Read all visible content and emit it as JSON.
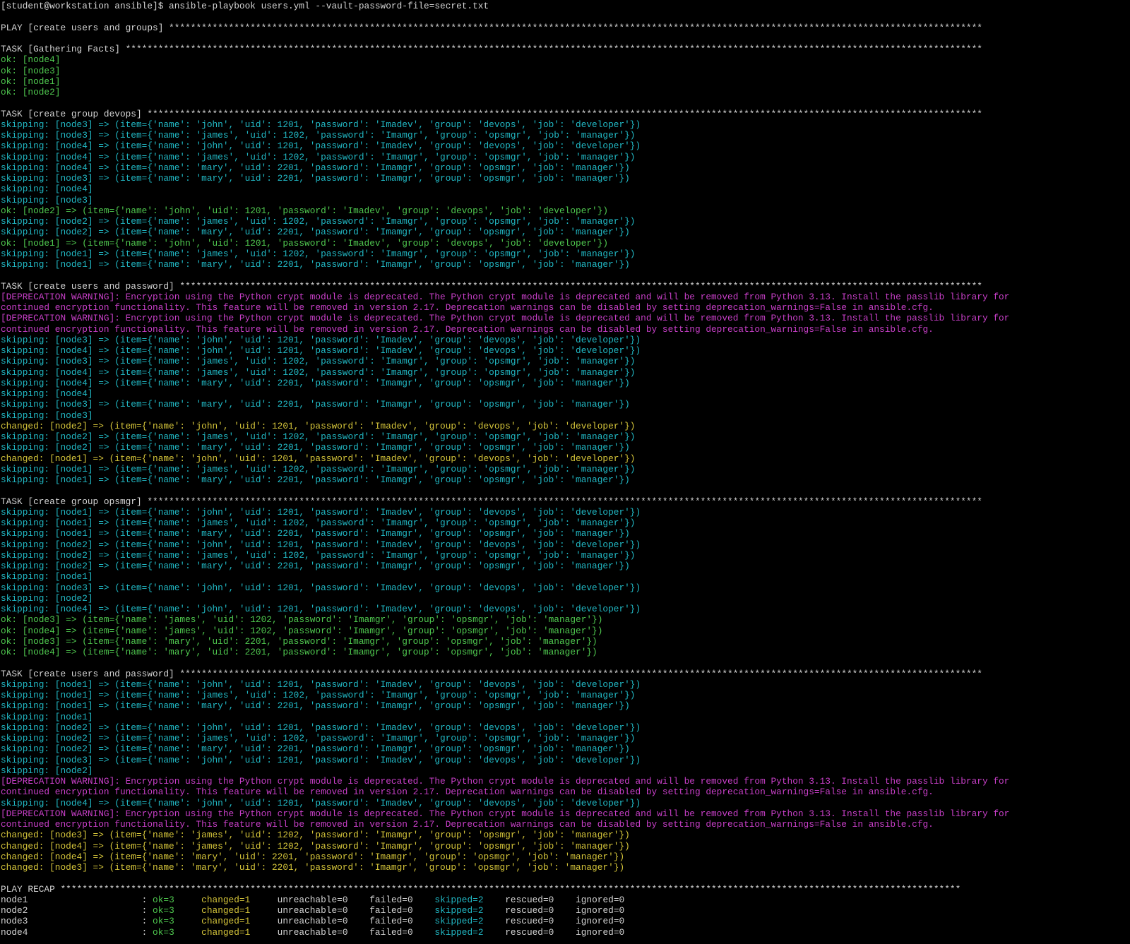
{
  "terminal": {
    "colors": {
      "background": "#000000",
      "default": "#d4d4d4",
      "ok": "#4fc84f",
      "skipping": "#21b8c4",
      "changed": "#d4c43a",
      "warning": "#c83fc8"
    },
    "lines": [
      {
        "kind": "prompt",
        "text": "[student@workstation ansible]$ ansible-playbook users.yml --vault-password-file=secret.txt"
      },
      {
        "kind": "blank",
        "text": ""
      },
      {
        "kind": "header",
        "text": "PLAY [create users and groups] ******************************************************************************************************************************************************"
      },
      {
        "kind": "blank",
        "text": ""
      },
      {
        "kind": "header",
        "text": "TASK [Gathering Facts] **************************************************************************************************************************************************************"
      },
      {
        "kind": "ok",
        "text": "ok: [node4]"
      },
      {
        "kind": "ok",
        "text": "ok: [node3]"
      },
      {
        "kind": "ok",
        "text": "ok: [node1]"
      },
      {
        "kind": "ok",
        "text": "ok: [node2]"
      },
      {
        "kind": "blank",
        "text": ""
      },
      {
        "kind": "header",
        "text": "TASK [create group devops] **********************************************************************************************************************************************************"
      },
      {
        "kind": "skip",
        "text": "skipping: [node3] => (item={'name': 'john', 'uid': 1201, 'password': 'Imadev', 'group': 'devops', 'job': 'developer'})"
      },
      {
        "kind": "skip",
        "text": "skipping: [node3] => (item={'name': 'james', 'uid': 1202, 'password': 'Imamgr', 'group': 'opsmgr', 'job': 'manager'})"
      },
      {
        "kind": "skip",
        "text": "skipping: [node4] => (item={'name': 'john', 'uid': 1201, 'password': 'Imadev', 'group': 'devops', 'job': 'developer'})"
      },
      {
        "kind": "skip",
        "text": "skipping: [node4] => (item={'name': 'james', 'uid': 1202, 'password': 'Imamgr', 'group': 'opsmgr', 'job': 'manager'})"
      },
      {
        "kind": "skip",
        "text": "skipping: [node4] => (item={'name': 'mary', 'uid': 2201, 'password': 'Imamgr', 'group': 'opsmgr', 'job': 'manager'})"
      },
      {
        "kind": "skip",
        "text": "skipping: [node3] => (item={'name': 'mary', 'uid': 2201, 'password': 'Imamgr', 'group': 'opsmgr', 'job': 'manager'})"
      },
      {
        "kind": "skip",
        "text": "skipping: [node4]"
      },
      {
        "kind": "skip",
        "text": "skipping: [node3]"
      },
      {
        "kind": "ok",
        "text": "ok: [node2] => (item={'name': 'john', 'uid': 1201, 'password': 'Imadev', 'group': 'devops', 'job': 'developer'})"
      },
      {
        "kind": "skip",
        "text": "skipping: [node2] => (item={'name': 'james', 'uid': 1202, 'password': 'Imamgr', 'group': 'opsmgr', 'job': 'manager'})"
      },
      {
        "kind": "skip",
        "text": "skipping: [node2] => (item={'name': 'mary', 'uid': 2201, 'password': 'Imamgr', 'group': 'opsmgr', 'job': 'manager'})"
      },
      {
        "kind": "ok",
        "text": "ok: [node1] => (item={'name': 'john', 'uid': 1201, 'password': 'Imadev', 'group': 'devops', 'job': 'developer'})"
      },
      {
        "kind": "skip",
        "text": "skipping: [node1] => (item={'name': 'james', 'uid': 1202, 'password': 'Imamgr', 'group': 'opsmgr', 'job': 'manager'})"
      },
      {
        "kind": "skip",
        "text": "skipping: [node1] => (item={'name': 'mary', 'uid': 2201, 'password': 'Imamgr', 'group': 'opsmgr', 'job': 'manager'})"
      },
      {
        "kind": "blank",
        "text": ""
      },
      {
        "kind": "header",
        "text": "TASK [create users and password] ****************************************************************************************************************************************************"
      },
      {
        "kind": "warn",
        "text": "[DEPRECATION WARNING]: Encryption using the Python crypt module is deprecated. The Python crypt module is deprecated and will be removed from Python 3.13. Install the passlib library for"
      },
      {
        "kind": "warn",
        "text": "continued encryption functionality. This feature will be removed in version 2.17. Deprecation warnings can be disabled by setting deprecation_warnings=False in ansible.cfg."
      },
      {
        "kind": "warn",
        "text": "[DEPRECATION WARNING]: Encryption using the Python crypt module is deprecated. The Python crypt module is deprecated and will be removed from Python 3.13. Install the passlib library for"
      },
      {
        "kind": "warn",
        "text": "continued encryption functionality. This feature will be removed in version 2.17. Deprecation warnings can be disabled by setting deprecation_warnings=False in ansible.cfg."
      },
      {
        "kind": "skip",
        "text": "skipping: [node3] => (item={'name': 'john', 'uid': 1201, 'password': 'Imadev', 'group': 'devops', 'job': 'developer'})"
      },
      {
        "kind": "skip",
        "text": "skipping: [node4] => (item={'name': 'john', 'uid': 1201, 'password': 'Imadev', 'group': 'devops', 'job': 'developer'})"
      },
      {
        "kind": "skip",
        "text": "skipping: [node3] => (item={'name': 'james', 'uid': 1202, 'password': 'Imamgr', 'group': 'opsmgr', 'job': 'manager'})"
      },
      {
        "kind": "skip",
        "text": "skipping: [node4] => (item={'name': 'james', 'uid': 1202, 'password': 'Imamgr', 'group': 'opsmgr', 'job': 'manager'})"
      },
      {
        "kind": "skip",
        "text": "skipping: [node4] => (item={'name': 'mary', 'uid': 2201, 'password': 'Imamgr', 'group': 'opsmgr', 'job': 'manager'})"
      },
      {
        "kind": "skip",
        "text": "skipping: [node4]"
      },
      {
        "kind": "skip",
        "text": "skipping: [node3] => (item={'name': 'mary', 'uid': 2201, 'password': 'Imamgr', 'group': 'opsmgr', 'job': 'manager'})"
      },
      {
        "kind": "skip",
        "text": "skipping: [node3]"
      },
      {
        "kind": "changed",
        "text": "changed: [node2] => (item={'name': 'john', 'uid': 1201, 'password': 'Imadev', 'group': 'devops', 'job': 'developer'})"
      },
      {
        "kind": "skip",
        "text": "skipping: [node2] => (item={'name': 'james', 'uid': 1202, 'password': 'Imamgr', 'group': 'opsmgr', 'job': 'manager'})"
      },
      {
        "kind": "skip",
        "text": "skipping: [node2] => (item={'name': 'mary', 'uid': 2201, 'password': 'Imamgr', 'group': 'opsmgr', 'job': 'manager'})"
      },
      {
        "kind": "changed",
        "text": "changed: [node1] => (item={'name': 'john', 'uid': 1201, 'password': 'Imadev', 'group': 'devops', 'job': 'developer'})"
      },
      {
        "kind": "skip",
        "text": "skipping: [node1] => (item={'name': 'james', 'uid': 1202, 'password': 'Imamgr', 'group': 'opsmgr', 'job': 'manager'})"
      },
      {
        "kind": "skip",
        "text": "skipping: [node1] => (item={'name': 'mary', 'uid': 2201, 'password': 'Imamgr', 'group': 'opsmgr', 'job': 'manager'})"
      },
      {
        "kind": "blank",
        "text": ""
      },
      {
        "kind": "header",
        "text": "TASK [create group opsmgr] **********************************************************************************************************************************************************"
      },
      {
        "kind": "skip",
        "text": "skipping: [node1] => (item={'name': 'john', 'uid': 1201, 'password': 'Imadev', 'group': 'devops', 'job': 'developer'})"
      },
      {
        "kind": "skip",
        "text": "skipping: [node1] => (item={'name': 'james', 'uid': 1202, 'password': 'Imamgr', 'group': 'opsmgr', 'job': 'manager'})"
      },
      {
        "kind": "skip",
        "text": "skipping: [node1] => (item={'name': 'mary', 'uid': 2201, 'password': 'Imamgr', 'group': 'opsmgr', 'job': 'manager'})"
      },
      {
        "kind": "skip",
        "text": "skipping: [node2] => (item={'name': 'john', 'uid': 1201, 'password': 'Imadev', 'group': 'devops', 'job': 'developer'})"
      },
      {
        "kind": "skip",
        "text": "skipping: [node2] => (item={'name': 'james', 'uid': 1202, 'password': 'Imamgr', 'group': 'opsmgr', 'job': 'manager'})"
      },
      {
        "kind": "skip",
        "text": "skipping: [node2] => (item={'name': 'mary', 'uid': 2201, 'password': 'Imamgr', 'group': 'opsmgr', 'job': 'manager'})"
      },
      {
        "kind": "skip",
        "text": "skipping: [node1]"
      },
      {
        "kind": "skip",
        "text": "skipping: [node3] => (item={'name': 'john', 'uid': 1201, 'password': 'Imadev', 'group': 'devops', 'job': 'developer'})"
      },
      {
        "kind": "skip",
        "text": "skipping: [node2]"
      },
      {
        "kind": "skip",
        "text": "skipping: [node4] => (item={'name': 'john', 'uid': 1201, 'password': 'Imadev', 'group': 'devops', 'job': 'developer'})"
      },
      {
        "kind": "ok",
        "text": "ok: [node3] => (item={'name': 'james', 'uid': 1202, 'password': 'Imamgr', 'group': 'opsmgr', 'job': 'manager'})"
      },
      {
        "kind": "ok",
        "text": "ok: [node4] => (item={'name': 'james', 'uid': 1202, 'password': 'Imamgr', 'group': 'opsmgr', 'job': 'manager'})"
      },
      {
        "kind": "ok",
        "text": "ok: [node3] => (item={'name': 'mary', 'uid': 2201, 'password': 'Imamgr', 'group': 'opsmgr', 'job': 'manager'})"
      },
      {
        "kind": "ok",
        "text": "ok: [node4] => (item={'name': 'mary', 'uid': 2201, 'password': 'Imamgr', 'group': 'opsmgr', 'job': 'manager'})"
      },
      {
        "kind": "blank",
        "text": ""
      },
      {
        "kind": "header",
        "text": "TASK [create users and password] ****************************************************************************************************************************************************"
      },
      {
        "kind": "skip",
        "text": "skipping: [node1] => (item={'name': 'john', 'uid': 1201, 'password': 'Imadev', 'group': 'devops', 'job': 'developer'})"
      },
      {
        "kind": "skip",
        "text": "skipping: [node1] => (item={'name': 'james', 'uid': 1202, 'password': 'Imamgr', 'group': 'opsmgr', 'job': 'manager'})"
      },
      {
        "kind": "skip",
        "text": "skipping: [node1] => (item={'name': 'mary', 'uid': 2201, 'password': 'Imamgr', 'group': 'opsmgr', 'job': 'manager'})"
      },
      {
        "kind": "skip",
        "text": "skipping: [node1]"
      },
      {
        "kind": "skip",
        "text": "skipping: [node2] => (item={'name': 'john', 'uid': 1201, 'password': 'Imadev', 'group': 'devops', 'job': 'developer'})"
      },
      {
        "kind": "skip",
        "text": "skipping: [node2] => (item={'name': 'james', 'uid': 1202, 'password': 'Imamgr', 'group': 'opsmgr', 'job': 'manager'})"
      },
      {
        "kind": "skip",
        "text": "skipping: [node2] => (item={'name': 'mary', 'uid': 2201, 'password': 'Imamgr', 'group': 'opsmgr', 'job': 'manager'})"
      },
      {
        "kind": "skip",
        "text": "skipping: [node3] => (item={'name': 'john', 'uid': 1201, 'password': 'Imadev', 'group': 'devops', 'job': 'developer'})"
      },
      {
        "kind": "skip",
        "text": "skipping: [node2]"
      },
      {
        "kind": "warn",
        "text": "[DEPRECATION WARNING]: Encryption using the Python crypt module is deprecated. The Python crypt module is deprecated and will be removed from Python 3.13. Install the passlib library for"
      },
      {
        "kind": "warn",
        "text": "continued encryption functionality. This feature will be removed in version 2.17. Deprecation warnings can be disabled by setting deprecation_warnings=False in ansible.cfg."
      },
      {
        "kind": "skip",
        "text": "skipping: [node4] => (item={'name': 'john', 'uid': 1201, 'password': 'Imadev', 'group': 'devops', 'job': 'developer'})"
      },
      {
        "kind": "warn",
        "text": "[DEPRECATION WARNING]: Encryption using the Python crypt module is deprecated. The Python crypt module is deprecated and will be removed from Python 3.13. Install the passlib library for"
      },
      {
        "kind": "warn",
        "text": "continued encryption functionality. This feature will be removed in version 2.17. Deprecation warnings can be disabled by setting deprecation_warnings=False in ansible.cfg."
      },
      {
        "kind": "changed",
        "text": "changed: [node3] => (item={'name': 'james', 'uid': 1202, 'password': 'Imamgr', 'group': 'opsmgr', 'job': 'manager'})"
      },
      {
        "kind": "changed",
        "text": "changed: [node4] => (item={'name': 'james', 'uid': 1202, 'password': 'Imamgr', 'group': 'opsmgr', 'job': 'manager'})"
      },
      {
        "kind": "changed",
        "text": "changed: [node4] => (item={'name': 'mary', 'uid': 2201, 'password': 'Imamgr', 'group': 'opsmgr', 'job': 'manager'})"
      },
      {
        "kind": "changed",
        "text": "changed: [node3] => (item={'name': 'mary', 'uid': 2201, 'password': 'Imamgr', 'group': 'opsmgr', 'job': 'manager'})"
      },
      {
        "kind": "blank",
        "text": ""
      },
      {
        "kind": "header",
        "text": "PLAY RECAP **********************************************************************************************************************************************************************"
      }
    ],
    "recap": [
      {
        "host": "node1",
        "ok": "ok=3",
        "changed": "changed=1",
        "unreachable": "unreachable=0",
        "failed": "failed=0",
        "skipped": "skipped=2",
        "rescued": "rescued=0",
        "ignored": "ignored=0"
      },
      {
        "host": "node2",
        "ok": "ok=3",
        "changed": "changed=1",
        "unreachable": "unreachable=0",
        "failed": "failed=0",
        "skipped": "skipped=2",
        "rescued": "rescued=0",
        "ignored": "ignored=0"
      },
      {
        "host": "node3",
        "ok": "ok=3",
        "changed": "changed=1",
        "unreachable": "unreachable=0",
        "failed": "failed=0",
        "skipped": "skipped=2",
        "rescued": "rescued=0",
        "ignored": "ignored=0"
      },
      {
        "host": "node4",
        "ok": "ok=3",
        "changed": "changed=1",
        "unreachable": "unreachable=0",
        "failed": "failed=0",
        "skipped": "skipped=2",
        "rescued": "rescued=0",
        "ignored": "ignored=0"
      }
    ]
  }
}
